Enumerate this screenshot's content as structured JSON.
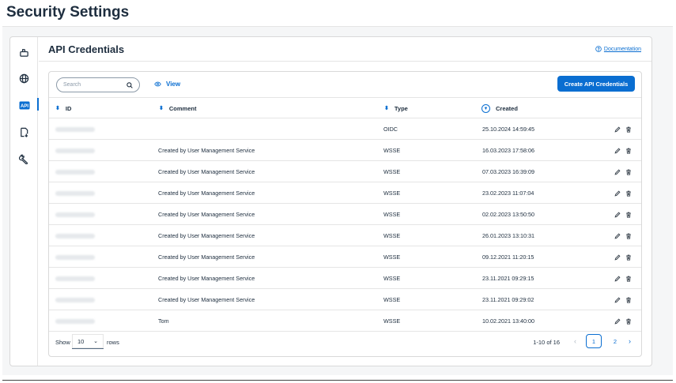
{
  "page": {
    "title": "Security Settings"
  },
  "sidebar": {
    "items": [
      {
        "icon": "mailbox-icon",
        "active": false
      },
      {
        "icon": "globe-icon",
        "active": false
      },
      {
        "icon": "api-icon",
        "active": true
      },
      {
        "icon": "document-download-icon",
        "active": false
      },
      {
        "icon": "wrench-icon",
        "active": false
      }
    ]
  },
  "card": {
    "title": "API Credentials",
    "documentation_label": "Documentation"
  },
  "toolbar": {
    "search_placeholder": "Search",
    "view_label": "View",
    "create_label": "Create API Credentials"
  },
  "table": {
    "columns": {
      "id": "ID",
      "comment": "Comment",
      "type": "Type",
      "created": "Created"
    },
    "rows": [
      {
        "comment": "",
        "type": "OIDC",
        "created": "25.10.2024 14:59:45"
      },
      {
        "comment": "Created by User Management Service",
        "type": "WSSE",
        "created": "16.03.2023 17:58:06"
      },
      {
        "comment": "Created by User Management Service",
        "type": "WSSE",
        "created": "07.03.2023 16:39:09"
      },
      {
        "comment": "Created by User Management Service",
        "type": "WSSE",
        "created": "23.02.2023 11:07:04"
      },
      {
        "comment": "Created by User Management Service",
        "type": "WSSE",
        "created": "02.02.2023 13:50:50"
      },
      {
        "comment": "Created by User Management Service",
        "type": "WSSE",
        "created": "26.01.2023 13:10:31"
      },
      {
        "comment": "Created by User Management Service",
        "type": "WSSE",
        "created": "09.12.2021 11:20:15"
      },
      {
        "comment": "Created by User Management Service",
        "type": "WSSE",
        "created": "23.11.2021 09:29:15"
      },
      {
        "comment": "Created by User Management Service",
        "type": "WSSE",
        "created": "23.11.2021 09:29:02"
      },
      {
        "comment": "Tom",
        "type": "WSSE",
        "created": "10.02.2021 13:40:00"
      }
    ]
  },
  "footer": {
    "show_label": "Show",
    "page_size": "10",
    "rows_label": "rows",
    "range_label": "1-10 of 16",
    "pages": [
      "1",
      "2"
    ],
    "current_page": "1"
  },
  "colors": {
    "accent": "#0a6ed1",
    "text": "#1d2d3e",
    "border": "#d9d9d9"
  }
}
